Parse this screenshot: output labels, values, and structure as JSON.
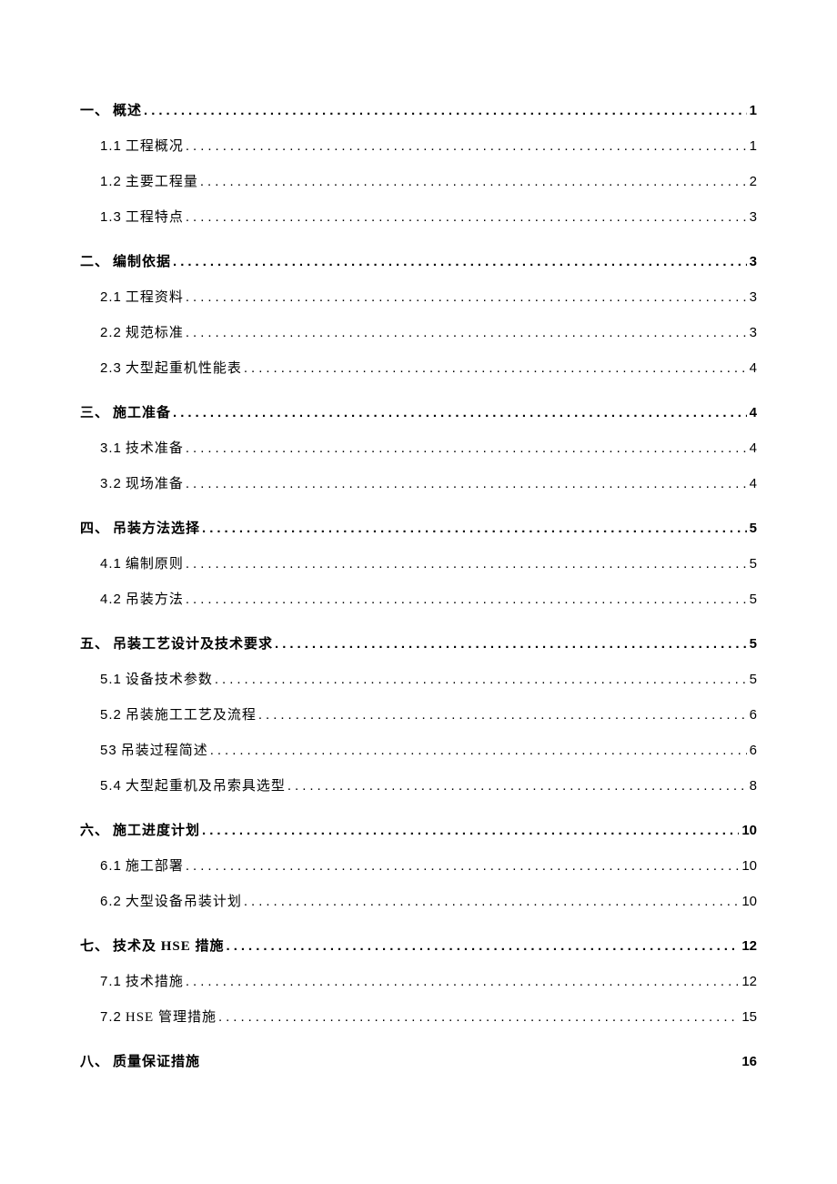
{
  "toc": [
    {
      "level": 1,
      "num": "一、",
      "title": "概述",
      "page": "1",
      "leader": true
    },
    {
      "level": 2,
      "num": "1.1",
      "title": "工程概况",
      "page": "1",
      "leader": true
    },
    {
      "level": 2,
      "num": "1.2",
      "title": "主要工程量",
      "page": "2",
      "leader": true
    },
    {
      "level": 2,
      "num": "1.3",
      "title": "工程特点",
      "page": "3",
      "leader": true
    },
    {
      "level": 1,
      "num": "二、",
      "title": "编制依据",
      "page": "3",
      "leader": true
    },
    {
      "level": 2,
      "num": "2.1",
      "title": "工程资料",
      "page": "3",
      "leader": true
    },
    {
      "level": 2,
      "num": "2.2",
      "title": "规范标准",
      "page": "3",
      "leader": true
    },
    {
      "level": 2,
      "num": "2.3",
      "title": "大型起重机性能表",
      "page": "4",
      "leader": true
    },
    {
      "level": 1,
      "num": "三、",
      "title": "施工准备",
      "page": "4",
      "leader": true
    },
    {
      "level": 2,
      "num": "3.1",
      "title": "技术准备",
      "page": "4",
      "leader": true
    },
    {
      "level": 2,
      "num": "3.2",
      "title": "现场准备",
      "page": "4",
      "leader": true
    },
    {
      "level": 1,
      "num": "四、",
      "title": "吊装方法选择",
      "page": "5",
      "leader": true
    },
    {
      "level": 2,
      "num": "4.1",
      "title": "编制原则",
      "page": "5",
      "leader": true
    },
    {
      "level": 2,
      "num": "4.2",
      "title": "吊装方法",
      "page": "5",
      "leader": true
    },
    {
      "level": 1,
      "num": "五、",
      "title": "吊装工艺设计及技术要求",
      "page": "5",
      "leader": true
    },
    {
      "level": 2,
      "num": "5.1",
      "title": "设备技术参数",
      "page": "5",
      "leader": true
    },
    {
      "level": 2,
      "num": "5.2",
      "title": "吊装施工工艺及流程",
      "page": "6",
      "leader": true
    },
    {
      "level": 2,
      "num": "53",
      "title": "吊装过程简述",
      "page": "6",
      "leader": true
    },
    {
      "level": 2,
      "num": "5.4",
      "title": "大型起重机及吊索具选型",
      "page": "8",
      "leader": true
    },
    {
      "level": 1,
      "num": "六、",
      "title": "施工进度计划",
      "page": "10",
      "leader": true
    },
    {
      "level": 2,
      "num": "6.1",
      "title": "施工部署",
      "page": "10",
      "leader": true
    },
    {
      "level": 2,
      "num": "6.2",
      "title": "大型设备吊装计划",
      "page": "10",
      "leader": true
    },
    {
      "level": 1,
      "num": "七、",
      "title": "技术及 HSE 措施",
      "page": "12",
      "leader": true
    },
    {
      "level": 2,
      "num": "7.1",
      "title": "技术措施",
      "page": "12",
      "leader": true
    },
    {
      "level": 2,
      "num": "7.2",
      "title": "HSE 管理措施",
      "page": "15",
      "leader": true
    },
    {
      "level": 1,
      "num": "八、",
      "title": "质量保证措施",
      "page": "16",
      "leader": false
    }
  ]
}
